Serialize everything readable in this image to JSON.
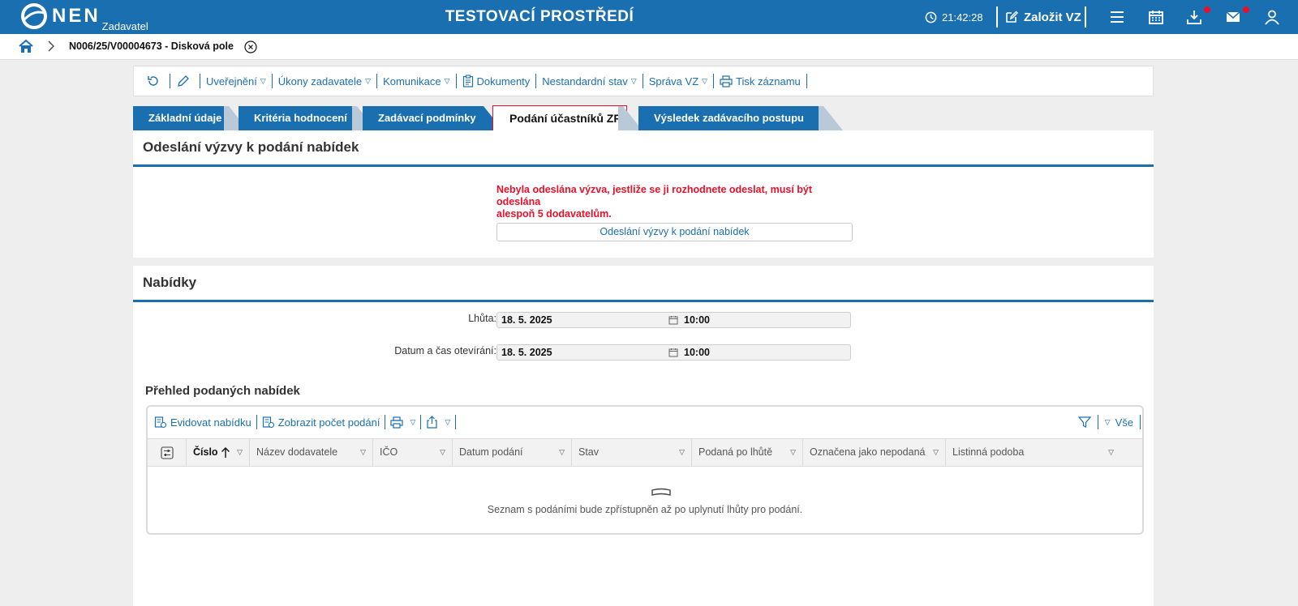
{
  "header": {
    "logo_text": "NEN",
    "logo_sub": "Zadavatel",
    "title": "TESTOVACÍ PROSTŘEDÍ",
    "clock": "21:42:28",
    "create_label": "Založit VZ",
    "icons": [
      "menu-icon",
      "calendar-icon",
      "download-icon",
      "mail-icon",
      "user-icon"
    ],
    "accent": "#1a6fb0",
    "notification_color": "#e8102a"
  },
  "breadcrumb": {
    "text": "N006/25/V00004673 - Disková pole"
  },
  "toolbar": {
    "items": [
      {
        "label": "Uveřejnění",
        "dropdown": true
      },
      {
        "label": "Úkony zadavatele",
        "dropdown": true
      },
      {
        "label": "Komunikace",
        "dropdown": true
      },
      {
        "label": "Dokumenty",
        "dropdown": false
      },
      {
        "label": "Nestandardní stav",
        "dropdown": true
      },
      {
        "label": "Správa VZ",
        "dropdown": true
      },
      {
        "label": "Tisk záznamu",
        "dropdown": false
      }
    ]
  },
  "tabs": [
    {
      "label": "Základní údaje"
    },
    {
      "label": "Kritéria hodnocení"
    },
    {
      "label": "Zadávací podmínky"
    },
    {
      "label": "Podání účastníků ZP",
      "active": true
    },
    {
      "label": "Výsledek zadávacího postupu"
    }
  ],
  "invite_section": {
    "title": "Odeslání výzvy k podání nabídek",
    "warning_line1": "Nebyla odeslána výzva, jestliže se ji rozhodnete odeslat, musí být odeslána",
    "warning_line2": "alespoň 5 dodavatelům.",
    "button_label": "Odeslání výzvy k podání nabídek"
  },
  "offers_section": {
    "title": "Nabídky",
    "deadline_label": "Lhůta:",
    "deadline_date": "18. 5. 2025",
    "deadline_time": "10:00",
    "opening_label": "Datum a čas otevírání:",
    "opening_date": "18. 5. 2025",
    "opening_time": "10:00",
    "overview_title": "Přehled podaných nabídek",
    "grid_toolbar": {
      "register_label": "Evidovat nabídku",
      "count_label": "Zobrazit počet podání",
      "filter_all_label": "Vše"
    },
    "columns": [
      "Číslo",
      "Název dodavatele",
      "IČO",
      "Datum podání",
      "Stav",
      "Podaná po lhůtě",
      "Označena jako nepodaná",
      "Listinná podoba"
    ],
    "empty_message": "Seznam s podáními bude zpřístupněn až po uplynutí lhůty pro podání."
  }
}
